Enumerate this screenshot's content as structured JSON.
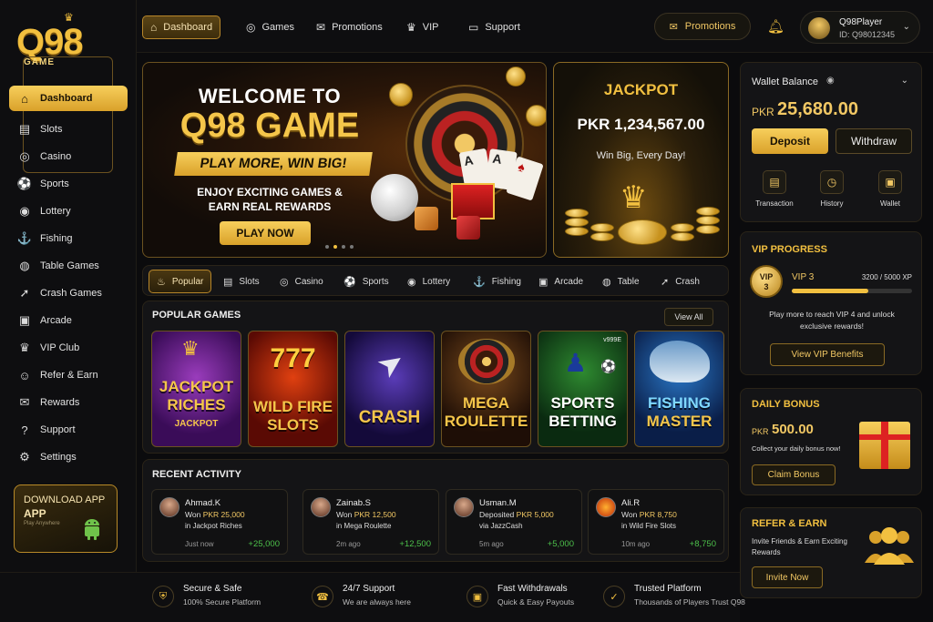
{
  "brand": {
    "logo_text": "Q98",
    "logo_sub": "GAME"
  },
  "sidebar": {
    "items": [
      {
        "label": "Dashboard",
        "icon": "home-icon"
      },
      {
        "label": "Slots",
        "icon": "slots-icon"
      },
      {
        "label": "Casino",
        "icon": "casino-chip-icon"
      },
      {
        "label": "Sports",
        "icon": "soccer-ball-icon"
      },
      {
        "label": "Lottery",
        "icon": "lottery-icon"
      },
      {
        "label": "Fishing",
        "icon": "fish-icon"
      },
      {
        "label": "Table Games",
        "icon": "table-games-icon"
      },
      {
        "label": "Crash Games",
        "icon": "rocket-icon"
      },
      {
        "label": "Arcade",
        "icon": "gamepad-icon"
      },
      {
        "label": "VIP Club",
        "icon": "crown-icon"
      },
      {
        "label": "Refer & Earn",
        "icon": "user-add-icon"
      },
      {
        "label": "Rewards",
        "icon": "gift-icon"
      },
      {
        "label": "Support",
        "icon": "help-icon"
      },
      {
        "label": "Settings",
        "icon": "gear-icon"
      }
    ],
    "download": {
      "line1": "DOWNLOAD APP",
      "line2": "APP",
      "line3": "Play Anywhere",
      "icon": "android-icon"
    }
  },
  "topnav": {
    "items": [
      {
        "label": "Dashboard",
        "icon": "home-icon"
      },
      {
        "label": "Games",
        "icon": "chip-icon"
      },
      {
        "label": "Promotions",
        "icon": "gift-icon"
      },
      {
        "label": "VIP",
        "icon": "crown-icon"
      },
      {
        "label": "Support",
        "icon": "chat-icon"
      }
    ],
    "promo_button": "Promotions",
    "user": {
      "name": "Q98Player",
      "id": "ID: Q98012345"
    }
  },
  "banner": {
    "line1": "WELCOME TO",
    "line2": "Q98 GAME",
    "tagline": "PLAY MORE, WIN BIG!",
    "sub1": "ENJOY EXCITING GAMES &",
    "sub2": "EARN REAL REWARDS",
    "cta": "PLAY NOW",
    "slide_index": 2,
    "slide_count": 4
  },
  "jackpot": {
    "title": "JACKPOT",
    "amount": "PKR 1,234,567.00",
    "subtitle": "Win Big, Every Day!"
  },
  "wallet": {
    "label": "Wallet Balance",
    "currency": "PKR",
    "balance": "25,680.00",
    "deposit": "Deposit",
    "withdraw": "Withdraw",
    "quick": [
      {
        "label": "Transaction",
        "icon": "receipt-icon"
      },
      {
        "label": "History",
        "icon": "clock-icon"
      },
      {
        "label": "Wallet",
        "icon": "wallet-icon"
      }
    ]
  },
  "vip": {
    "title": "VIP PROGRESS",
    "badge_line1": "VIP",
    "badge_line2": "3",
    "level": "VIP 3",
    "points": "3200 / 5000 XP",
    "progress": 0.64,
    "message": "Play more to reach VIP 4 and unlock exclusive rewards!",
    "button": "View VIP Benefits"
  },
  "daily_bonus": {
    "title": "DAILY BONUS",
    "currency": "PKR",
    "amount": "500.00",
    "subtitle": "Collect your daily bonus now!",
    "button": "Claim Bonus"
  },
  "refer": {
    "title": "REFER & EARN",
    "subtitle": "Invite Friends & Earn Exciting Rewards",
    "button": "Invite Now"
  },
  "categories": [
    {
      "label": "Popular",
      "icon": "fire-icon"
    },
    {
      "label": "Slots",
      "icon": "slots-icon"
    },
    {
      "label": "Casino",
      "icon": "casino-chip-icon"
    },
    {
      "label": "Sports",
      "icon": "soccer-ball-icon"
    },
    {
      "label": "Lottery",
      "icon": "lottery-icon"
    },
    {
      "label": "Fishing",
      "icon": "fish-icon"
    },
    {
      "label": "Arcade",
      "icon": "gamepad-icon"
    },
    {
      "label": "Table",
      "icon": "table-games-icon"
    },
    {
      "label": "Crash",
      "icon": "rocket-icon"
    }
  ],
  "popular": {
    "title": "POPULAR GAMES",
    "view_all": "View All",
    "games": [
      {
        "line1": "JACKPOT",
        "line2": "RICHES",
        "tag": "JACKPOT",
        "color1": "#f5c64a",
        "color2": "#f5c64a"
      },
      {
        "line1": "WILD FIRE",
        "line2": "SLOTS",
        "tag": "777",
        "color1": "#f5c64a",
        "color2": "#f5c64a"
      },
      {
        "line1": "CRASH",
        "line2": "",
        "tag": "",
        "color1": "#f5c64a",
        "color2": "#f5c64a"
      },
      {
        "line1": "MEGA",
        "line2": "ROULETTE",
        "tag": "",
        "color1": "#f5c64a",
        "color2": "#f5c64a"
      },
      {
        "line1": "SPORTS",
        "line2": "BETTING",
        "tag": "v999E",
        "color1": "#ffffff",
        "color2": "#ffffff"
      },
      {
        "line1": "FISHING",
        "line2": "MASTER",
        "tag": "",
        "color1": "#7fd8ff",
        "color2": "#f5c64a"
      }
    ]
  },
  "recent": {
    "title": "RECENT ACTIVITY",
    "items": [
      {
        "name": "Ahmad.K",
        "verb": "Won",
        "value": "PKR 25,000",
        "detail": "in Jackpot Riches",
        "time": "Just now",
        "amount": "+25,000"
      },
      {
        "name": "Zainab.S",
        "verb": "Won",
        "value": "PKR 12,500",
        "detail": "in Mega Roulette",
        "time": "2m ago",
        "amount": "+12,500"
      },
      {
        "name": "Usman.M",
        "verb": "Deposited",
        "value": "PKR 5,000",
        "detail": "via JazzCash",
        "time": "5m ago",
        "amount": "+5,000"
      },
      {
        "name": "Ali.R",
        "verb": "Won",
        "value": "PKR 8,750",
        "detail": "in Wild Fire Slots",
        "time": "10m ago",
        "amount": "+8,750"
      }
    ]
  },
  "footer": {
    "features": [
      {
        "title": "Secure & Safe",
        "sub": "100% Secure Platform",
        "icon": "shield-icon"
      },
      {
        "title": "24/7 Support",
        "sub": "We are always here",
        "icon": "headset-icon"
      },
      {
        "title": "Fast Withdrawals",
        "sub": "Quick & Easy Payouts",
        "icon": "wallet-icon"
      },
      {
        "title": "Trusted Platform",
        "sub": "Thousands of Players Trust Q98",
        "icon": "badge-check-icon"
      }
    ]
  },
  "colors": {
    "accent": "#f2c040",
    "background": "#0b0b0d",
    "positive": "#4cc04a"
  }
}
